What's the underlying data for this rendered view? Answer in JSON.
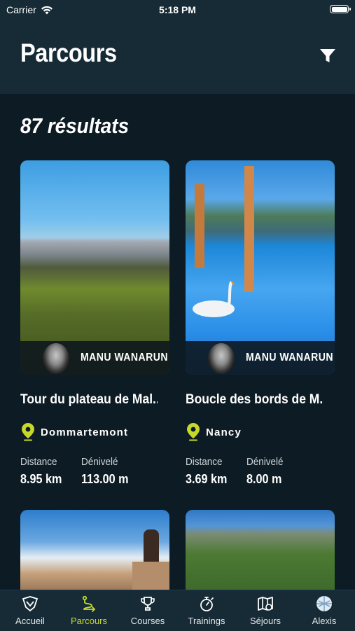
{
  "status_bar": {
    "carrier": "Carrier",
    "time": "5:18 PM"
  },
  "header": {
    "title": "Parcours"
  },
  "results": {
    "count_label": "87 résultats"
  },
  "stat_labels": {
    "distance": "Distance",
    "elevation": "Dénivelé"
  },
  "routes": [
    {
      "author": "MANU WANARUN",
      "name": "Tour du plateau de Mal...",
      "city": "Dommartemont",
      "distance": "8.95 km",
      "elevation": "113.00 m"
    },
    {
      "author": "MANU WANARUN",
      "name": "Boucle des bords de M...",
      "city": "Nancy",
      "distance": "3.69 km",
      "elevation": "8.00 m"
    }
  ],
  "tabs": [
    {
      "label": "Accueil",
      "icon": "home-logo-icon"
    },
    {
      "label": "Parcours",
      "icon": "route-icon",
      "active": true
    },
    {
      "label": "Courses",
      "icon": "trophy-icon"
    },
    {
      "label": "Trainings",
      "icon": "stopwatch-icon"
    },
    {
      "label": "Séjours",
      "icon": "map-icon"
    },
    {
      "label": "Alexis",
      "icon": "avatar-icon"
    }
  ],
  "colors": {
    "accent": "#c6d92a",
    "background": "#0d1c24",
    "header": "#162b36"
  }
}
